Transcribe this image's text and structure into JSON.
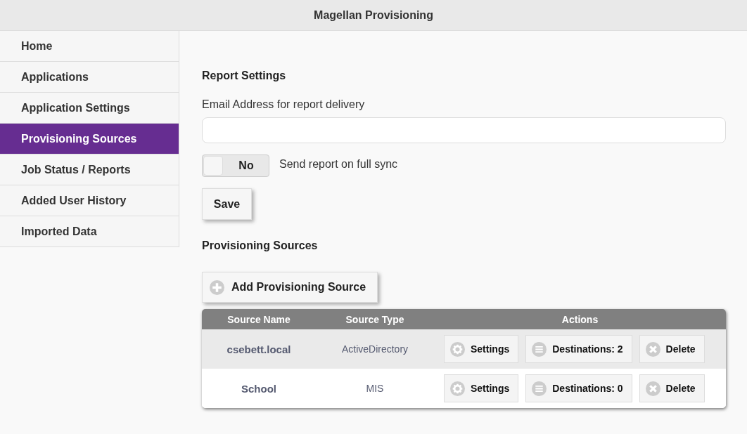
{
  "header": {
    "title": "Magellan Provisioning"
  },
  "sidebar": {
    "items": [
      {
        "label": "Home",
        "selected": false
      },
      {
        "label": "Applications",
        "selected": false
      },
      {
        "label": "Application Settings",
        "selected": false
      },
      {
        "label": "Provisioning Sources",
        "selected": true
      },
      {
        "label": "Job Status / Reports",
        "selected": false
      },
      {
        "label": "Added User History",
        "selected": false
      },
      {
        "label": "Imported Data",
        "selected": false
      }
    ]
  },
  "report_settings": {
    "heading": "Report Settings",
    "email_label": "Email Address for report delivery",
    "toggle": {
      "on": false,
      "text": "No",
      "label": "Send report on full sync"
    },
    "save_button": "Save"
  },
  "sources": {
    "heading": "Provisioning Sources",
    "add_button": "Add Provisioning Source",
    "table": {
      "columns": [
        "Source Name",
        "Source Type",
        "Actions"
      ],
      "rows": [
        {
          "name": "csebett.local",
          "type": "ActiveDirectory",
          "actions": [
            {
              "kind": "settings",
              "label": "Settings"
            },
            {
              "kind": "destinations",
              "label": "Destinations: 2"
            },
            {
              "kind": "delete",
              "label": "Delete"
            }
          ]
        },
        {
          "name": "School",
          "type": "MIS",
          "actions": [
            {
              "kind": "settings",
              "label": "Settings"
            },
            {
              "kind": "destinations",
              "label": "Destinations: 0"
            },
            {
              "kind": "delete",
              "label": "Delete"
            }
          ]
        }
      ]
    }
  }
}
